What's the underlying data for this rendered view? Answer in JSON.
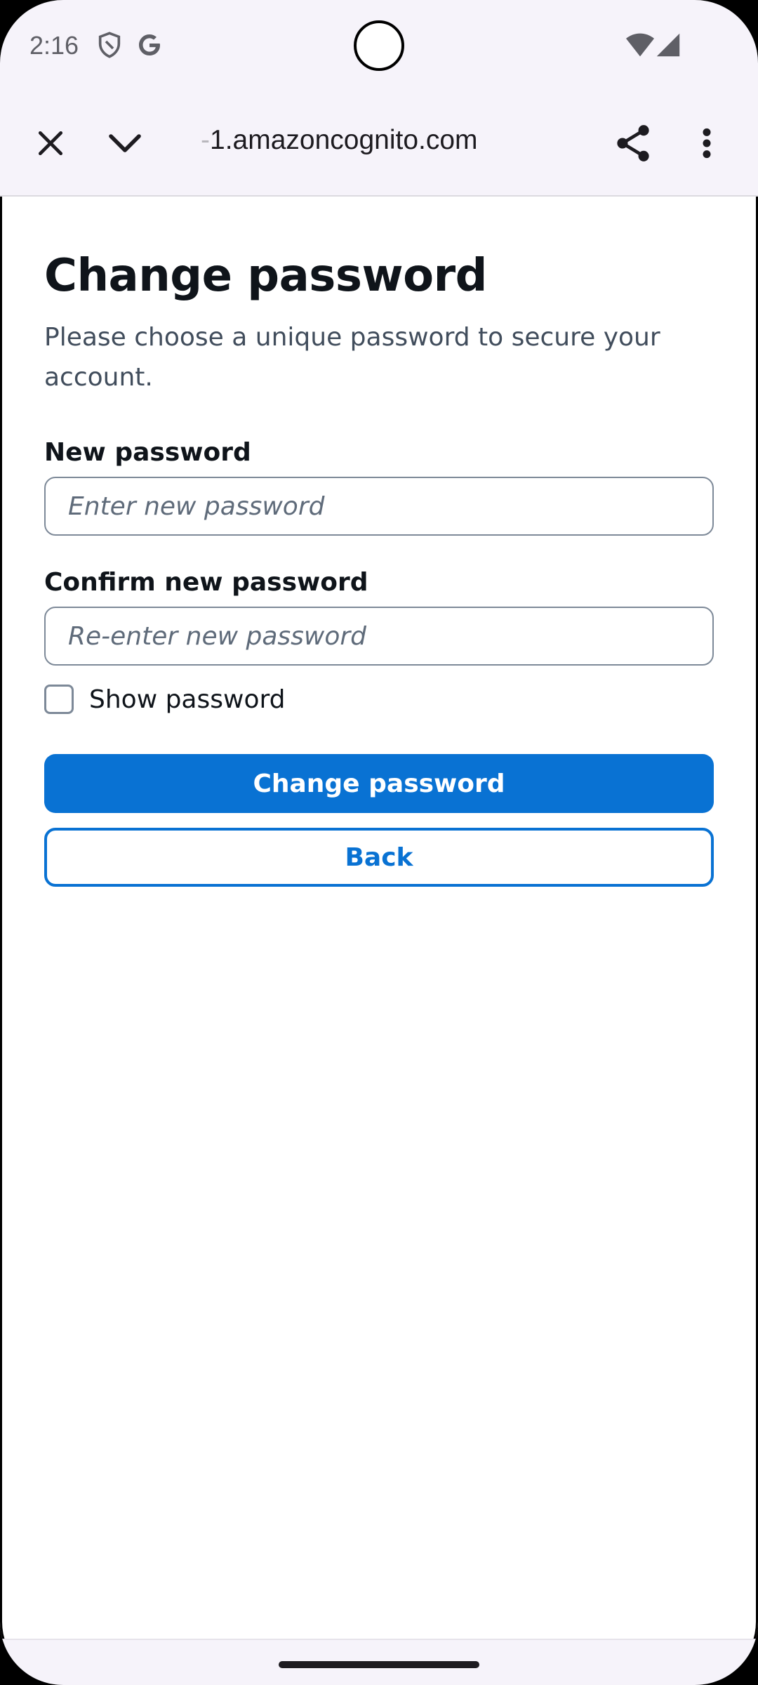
{
  "status_bar": {
    "time": "2:16",
    "icons": [
      "shield-icon",
      "google-icon",
      "wifi-icon",
      "signal-icon"
    ]
  },
  "toolbar": {
    "url_prefix": "-",
    "url": "1.amazoncognito.com",
    "icons": [
      "close-icon",
      "chevron-down-icon",
      "share-icon",
      "more-vert-icon"
    ]
  },
  "form": {
    "title": "Change password",
    "subtitle": "Please choose a unique password to secure your account.",
    "new_password_label": "New password",
    "new_password_placeholder": "Enter new password",
    "confirm_password_label": "Confirm new password",
    "confirm_password_placeholder": "Re-enter new password",
    "show_password_label": "Show password",
    "submit_label": "Change password",
    "back_label": "Back"
  },
  "colors": {
    "primary": "#0972d3",
    "title": "#0f141a",
    "subtitle": "#414d5c",
    "chrome_bg": "#f6f3fa"
  }
}
